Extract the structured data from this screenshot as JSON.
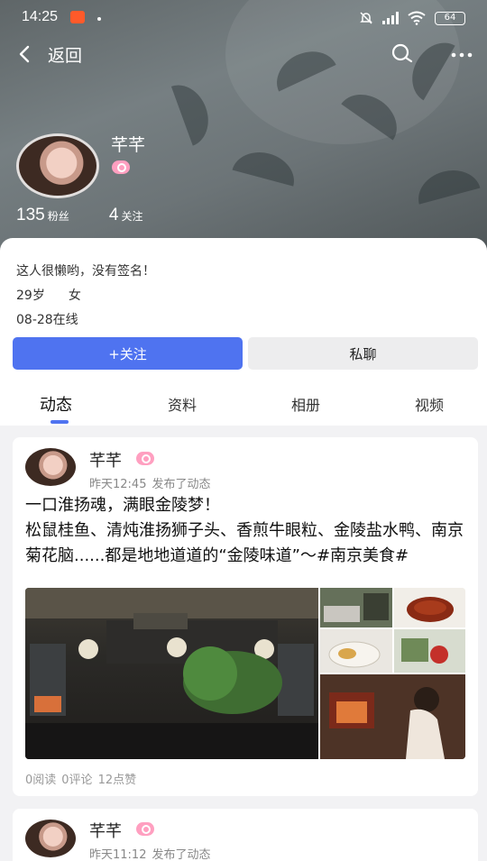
{
  "status_bar": {
    "time": "14:25",
    "battery": "64"
  },
  "nav": {
    "back_label": "返回"
  },
  "profile": {
    "name": "芊芊",
    "followers_count": "135",
    "followers_label": "粉丝",
    "following_count": "4",
    "following_label": "关注",
    "bio": "这人很懒哟，没有签名！",
    "age": "29岁",
    "gender": "女",
    "last_online": "08-28在线"
  },
  "actions": {
    "follow_label": "+关注",
    "chat_label": "私聊"
  },
  "tabs": [
    {
      "label": "动态",
      "active": true
    },
    {
      "label": "资料",
      "active": false
    },
    {
      "label": "相册",
      "active": false
    },
    {
      "label": "视频",
      "active": false
    }
  ],
  "posts": [
    {
      "author": "芊芊",
      "time": "昨天12:45",
      "action": "发布了动态",
      "text": "一口淮扬魂，满眼金陵梦！\n松鼠桂鱼、清炖淮扬狮子头、香煎牛眼粒、金陵盐水鸭、南京菊花脑......都是地地道道的“金陵味道”～#南京美食#",
      "reads": "0阅读",
      "comments": "0评论",
      "likes": "12点赞"
    },
    {
      "author": "芊芊",
      "time": "昨天11:12",
      "action": "发布了动态"
    }
  ],
  "colors": {
    "accent": "#4f73f0",
    "badge": "#ff9fc0"
  }
}
